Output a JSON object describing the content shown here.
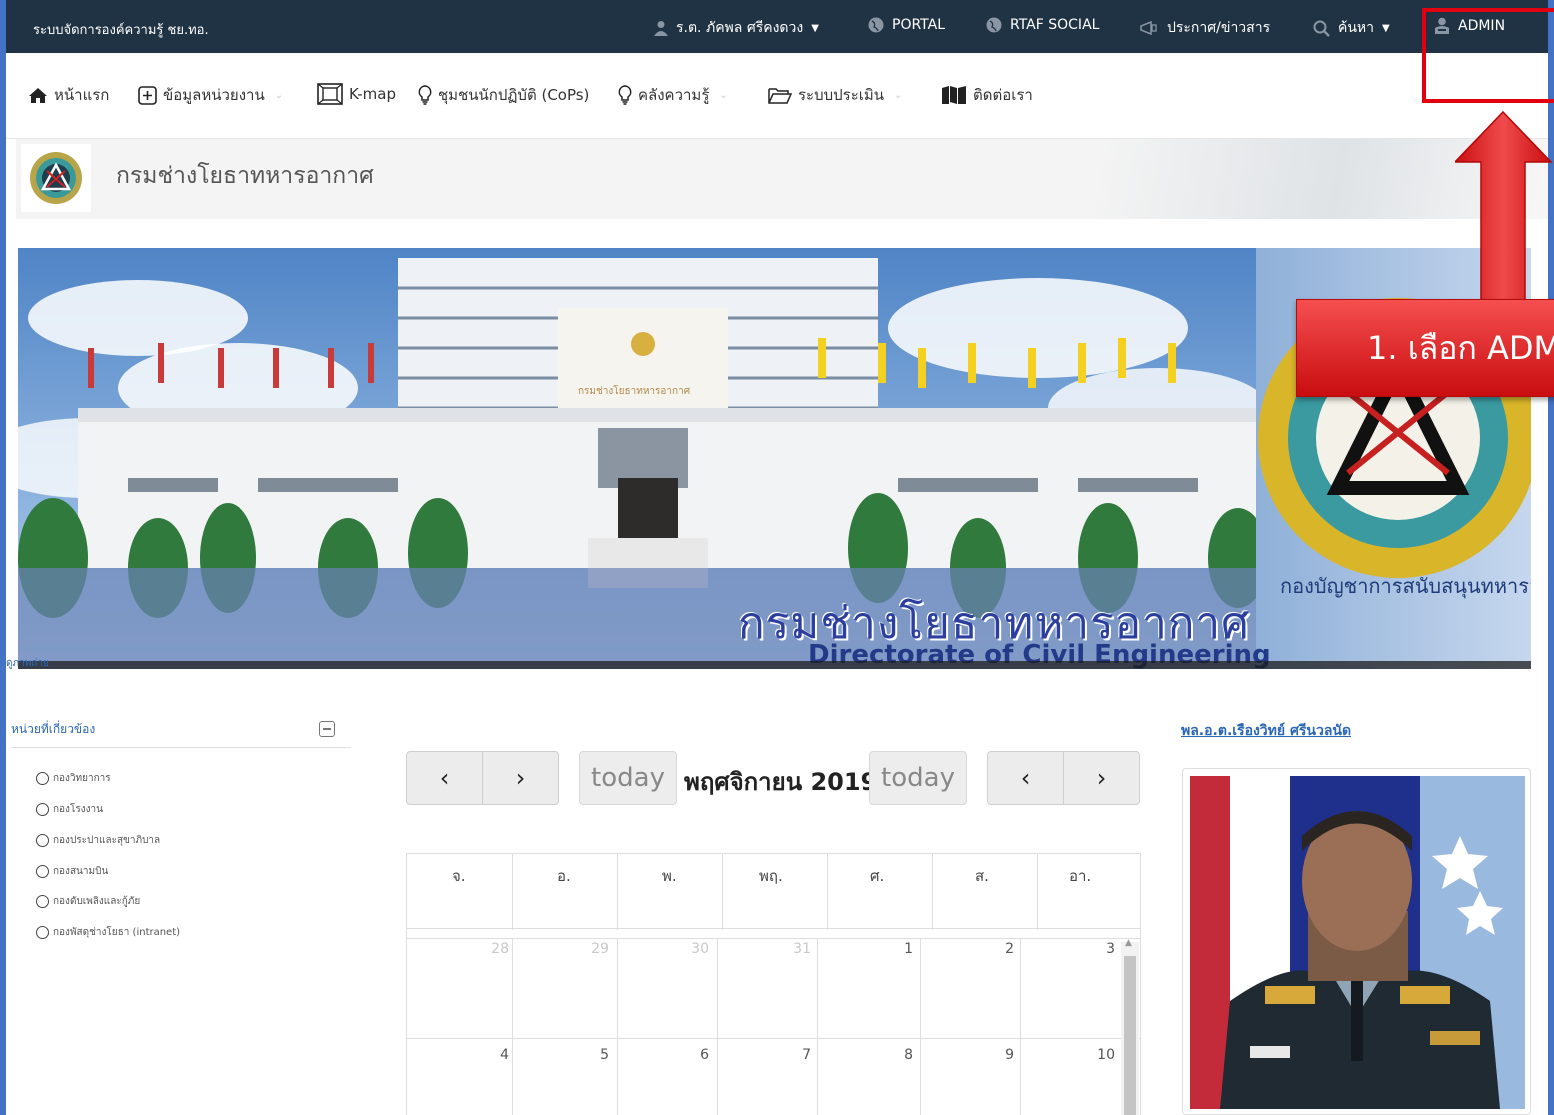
{
  "topbar": {
    "brand": "ระบบจัดการองค์ความรู้ ชย.ทอ.",
    "user": "ร.ต. ภัคพล ศรีคงดวง",
    "portal": "PORTAL",
    "social": "RTAF SOCIAL",
    "news": "ประกาศ/ข่าวสาร",
    "search": "ค้นหา",
    "admin": "ADMIN"
  },
  "nav": {
    "home": "หน้าแรก",
    "unit_info": "ข้อมูลหน่วยงาน",
    "kmap": "K-map",
    "cops": "ชุมชนนักปฏิบัติ (CoPs)",
    "knowledge": "คลังความรู้",
    "eval": "ระบบประเมิน",
    "contact": "ติดต่อเรา"
  },
  "org": {
    "title": "กรมช่างโยธาทหารอากาศ"
  },
  "banner": {
    "caption": "กรมช่างโยธาทหารอากาศ",
    "subcaption": "Directorate of Civil Engineering",
    "emblem_text": "กองบัญชาการสนับสนุนทหารอากาศ",
    "photo_caption": "ดูภาพถ่าย"
  },
  "units": {
    "title": "หน่วยที่เกี่ยวข้อง",
    "items": [
      "กองวิทยาการ",
      "กองโรงงาน",
      "กองประปาและสุขาภิบาล",
      "กองสนามบิน",
      "กองดับเพลิงและกู้ภัย",
      "กองพัสดุช่างโยธา (intranet)"
    ]
  },
  "calendar": {
    "title": "พฤศจิกายน 2019",
    "today": "today",
    "prev": "‹",
    "next": "›",
    "dow": [
      "จ.",
      "อ.",
      "พ.",
      "พฤ.",
      "ศ.",
      "ส.",
      "อา."
    ],
    "weeks": [
      [
        "28",
        "29",
        "30",
        "31",
        "1",
        "2",
        "3"
      ],
      [
        "4",
        "5",
        "6",
        "7",
        "8",
        "9",
        "10"
      ]
    ]
  },
  "commander": {
    "name": "พล.อ.ต.เรืองวิทย์ ศรีนวลนัด"
  },
  "annotation": {
    "callout": "1. เลือก ADMIN"
  },
  "colors": {
    "topbar": "#203344",
    "frame": "#4472c4",
    "link": "#2a67b8",
    "callout": "#e20010"
  }
}
